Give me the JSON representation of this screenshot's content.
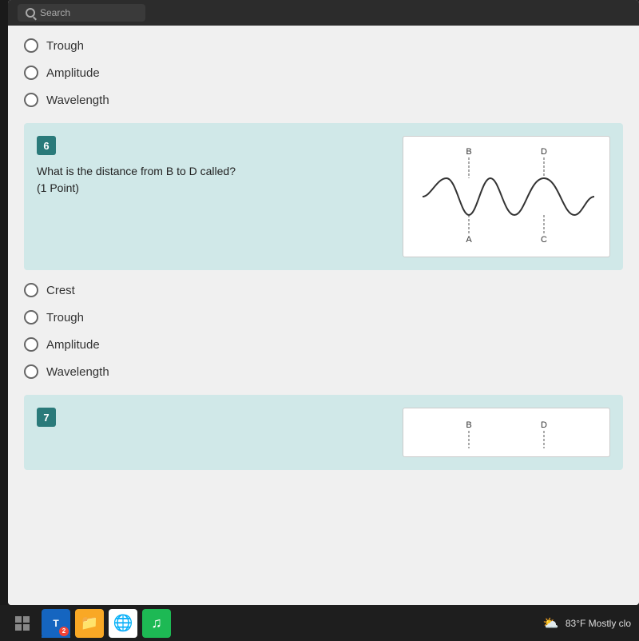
{
  "topbar": {
    "search_placeholder": "Search"
  },
  "question5": {
    "options": [
      {
        "label": "Trough"
      },
      {
        "label": "Amplitude"
      },
      {
        "label": "Wavelength"
      }
    ]
  },
  "question6": {
    "number": "6",
    "text": "What is the distance from B to D called?",
    "points": "(1 Point)",
    "options": [
      {
        "label": "Crest"
      },
      {
        "label": "Trough"
      },
      {
        "label": "Amplitude"
      },
      {
        "label": "Wavelength"
      }
    ],
    "diagram": {
      "labels": [
        "B",
        "D",
        "A",
        "C"
      ]
    }
  },
  "question7": {
    "number": "7",
    "diagram": {
      "labels": [
        "B",
        "D"
      ]
    }
  },
  "taskbar": {
    "weather": "83°F  Mostly clo"
  }
}
